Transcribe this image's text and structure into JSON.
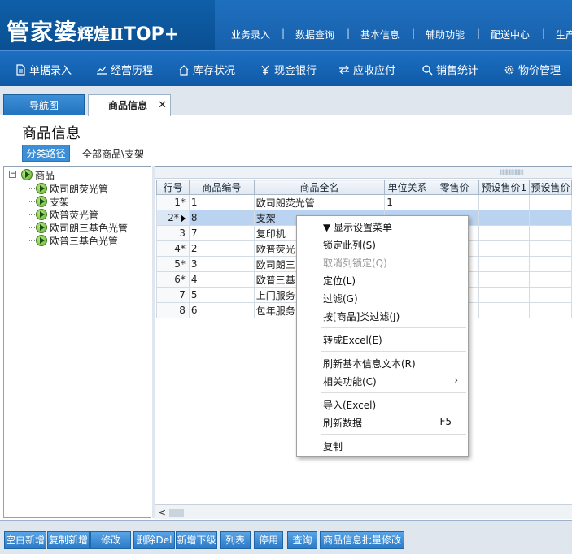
{
  "brand": {
    "name": "管家婆",
    "edition": "辉煌Ⅱ",
    "product": "TOP+"
  },
  "top_menu": [
    "业务录入",
    "数据查询",
    "基本信息",
    "辅助功能",
    "配送中心",
    "生产"
  ],
  "toolbar": [
    {
      "label": "单据录入",
      "icon": "document-icon"
    },
    {
      "label": "经营历程",
      "icon": "chart-icon"
    },
    {
      "label": "库存状况",
      "icon": "house-icon"
    },
    {
      "label": "现金银行",
      "icon": "yen-icon"
    },
    {
      "label": "应收应付",
      "icon": "exchange-icon"
    },
    {
      "label": "销售统计",
      "icon": "search-icon"
    },
    {
      "label": "物价管理",
      "icon": "gear-icon"
    }
  ],
  "tabs": [
    {
      "label": "导航图",
      "active": false
    },
    {
      "label": "商品信息",
      "active": true,
      "close": "✕"
    }
  ],
  "page": {
    "title": "商品信息",
    "path_button": "分类路径",
    "path_text": "全部商品\\支架"
  },
  "tree": {
    "collapse_glyph": "−",
    "root": "商品",
    "children": [
      "欧司朗荧光管",
      "支架",
      "欧普荧光管",
      "欧司朗三基色光管",
      "欧普三基色光管"
    ]
  },
  "grid": {
    "columns": [
      "行号",
      "商品编号",
      "商品全名",
      "单位关系",
      "零售价",
      "预设售价1",
      "预设售价"
    ],
    "rows": [
      {
        "rowno": "1*",
        "code": "1",
        "name": "欧司朗荧光管",
        "unit": "1",
        "selected": false
      },
      {
        "rowno": "2*",
        "code": "8",
        "name": "支架",
        "unit": "",
        "selected": true
      },
      {
        "rowno": "3",
        "code": "7",
        "name": "复印机",
        "unit": "",
        "selected": false
      },
      {
        "rowno": "4*",
        "code": "2",
        "name": "欧普荧光",
        "unit": "",
        "selected": false
      },
      {
        "rowno": "5*",
        "code": "3",
        "name": "欧司朗三",
        "unit": "",
        "selected": false
      },
      {
        "rowno": "6*",
        "code": "4",
        "name": "欧普三基",
        "unit": "",
        "selected": false
      },
      {
        "rowno": "7",
        "code": "5",
        "name": "上门服务",
        "unit": "",
        "selected": false
      },
      {
        "rowno": "8",
        "code": "6",
        "name": "包年服务",
        "unit": "",
        "selected": false
      }
    ],
    "scroll_left": "<"
  },
  "context_menu": {
    "header": "▼ 显示设置菜单",
    "items": [
      {
        "label": "锁定此列(S)",
        "disabled": false
      },
      {
        "label": "取消列锁定(Q)",
        "disabled": true
      },
      {
        "label": "定位(L)",
        "disabled": false
      },
      {
        "label": "过滤(G)",
        "disabled": false
      },
      {
        "label": "按[商品]类过滤(J)",
        "disabled": false
      },
      {
        "label": "转成Excel(E)",
        "disabled": false
      },
      {
        "label": "刷新基本信息文本(R)",
        "disabled": false
      },
      {
        "label": "相关功能(C)",
        "disabled": false,
        "submenu": "›"
      },
      {
        "label": "导入(Excel)",
        "disabled": false
      },
      {
        "label": "刷新数据",
        "disabled": false,
        "shortcut": "F5"
      },
      {
        "label": "复制",
        "disabled": false
      }
    ]
  },
  "bottom_buttons": [
    "空白新增",
    "复制新增",
    "修改",
    "删除Del",
    "新增下级",
    "列表",
    "停用",
    "查询",
    "商品信息批量修改"
  ],
  "colors": {
    "header_blue": "#0f5fa8",
    "toolbar_blue": "#1d6fc2",
    "selected_row": "#b9d3f0",
    "button_blue": "#2b7ac6"
  }
}
